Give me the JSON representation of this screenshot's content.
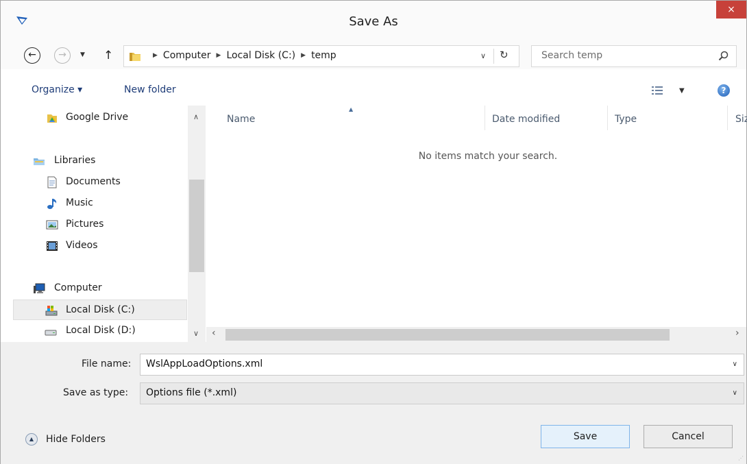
{
  "window": {
    "title": "Save As",
    "close_label": "×"
  },
  "address_bar": {
    "crumbs": [
      "Computer",
      "Local Disk (C:)",
      "temp"
    ],
    "search_placeholder": "Search temp"
  },
  "toolbar": {
    "organize_label": "Organize ▾",
    "new_folder_label": "New folder"
  },
  "nav": {
    "items": [
      {
        "label": "Google Drive",
        "icon": "google-drive-icon"
      },
      {
        "label": "Libraries",
        "icon": "libraries-icon"
      },
      {
        "label": "Documents",
        "icon": "documents-icon"
      },
      {
        "label": "Music",
        "icon": "music-icon"
      },
      {
        "label": "Pictures",
        "icon": "pictures-icon"
      },
      {
        "label": "Videos",
        "icon": "videos-icon"
      },
      {
        "label": "Computer",
        "icon": "computer-icon"
      },
      {
        "label": "Local Disk (C:)",
        "icon": "local-disk-icon",
        "selected": true
      },
      {
        "label": "Local Disk (D:)",
        "icon": "drive-icon"
      }
    ]
  },
  "content": {
    "columns": [
      "Name",
      "Date modified",
      "Type",
      "Siz"
    ],
    "empty_message": "No items match your search."
  },
  "form": {
    "file_name_label": "File name:",
    "file_name_value": "WslAppLoadOptions.xml",
    "save_type_label": "Save as type:",
    "save_type_value": "Options file (*.xml)"
  },
  "footer": {
    "hide_folders_label": "Hide Folders",
    "save_label": "Save",
    "cancel_label": "Cancel"
  },
  "colors": {
    "accent": "#1e3c78",
    "close": "#c7413a",
    "selection": "#eeeeee",
    "save_button": "#e5f1fb"
  }
}
